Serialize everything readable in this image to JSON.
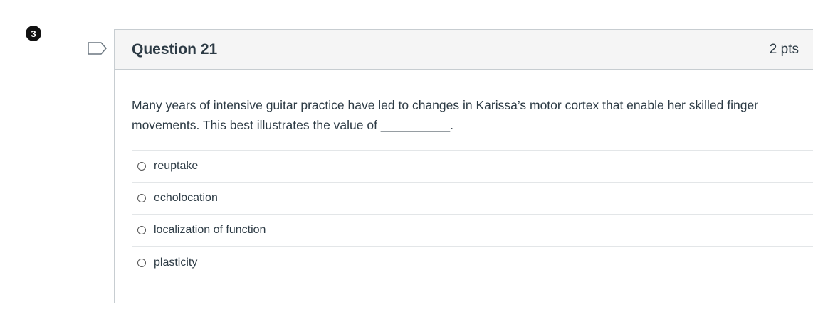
{
  "badge": {
    "number": "3"
  },
  "question": {
    "title": "Question 21",
    "points": "2 pts",
    "text": "Many years of intensive guitar practice have led to changes in Karissa’s motor cortex that enable her skilled finger movements. This best illustrates the value of __________."
  },
  "answers": [
    {
      "label": "reuptake"
    },
    {
      "label": "echolocation"
    },
    {
      "label": "localization of function"
    },
    {
      "label": "plasticity"
    }
  ],
  "icons": {
    "flag": "flag-outline-icon",
    "radio": "radio-button-icon"
  }
}
